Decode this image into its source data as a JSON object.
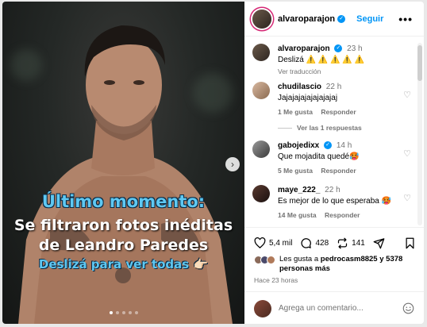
{
  "post": {
    "author": "alvaroparajon",
    "follow_label": "Seguir",
    "more_label": "•••"
  },
  "media": {
    "overlay_line1": "Último momento:",
    "overlay_line2": "Se filtraron fotos inéditas",
    "overlay_line3": "de Leandro Paredes",
    "overlay_line4": "Deslizá para ver todas 👉🏻",
    "next_arrow": "›",
    "carousel_dots": 5,
    "active_dot": 0
  },
  "caption": {
    "user": "alvaroparajon",
    "time": "23 h",
    "text": "Deslizá ⚠️ ⚠️ ⚠️ ⚠️ ⚠️",
    "translate": "Ver traducción"
  },
  "comments": [
    {
      "user": "chudilascio",
      "time": "22 h",
      "text": "Jajajajajajajajajaj",
      "likes": "1 Me gusta",
      "reply": "Responder",
      "verified": false
    },
    {
      "user": "gabojedixx",
      "time": "14 h",
      "text": "Que mojadita quedé🥵",
      "likes": "5 Me gusta",
      "reply": "Responder",
      "verified": true
    },
    {
      "user": "maye_222_",
      "time": "22 h",
      "text": "Es mejor de lo que esperaba 🥵",
      "likes": "14 Me gusta",
      "reply": "Responder",
      "verified": false
    }
  ],
  "view_replies": "Ver las 1 respuestas",
  "actions": {
    "likes_count": "5,4 mil",
    "comments_count": "428",
    "reposts_count": "141"
  },
  "liked_by": {
    "prefix": "Les gusta a ",
    "user": "pedrocasm8825",
    "suffix": " y 5378 personas más"
  },
  "time_ago": "Hace 23 horas",
  "add_comment_placeholder": "Agrega un comentario...",
  "colors": {
    "accent": "#0095f6",
    "overlay_blue": "#5ec8f2"
  }
}
